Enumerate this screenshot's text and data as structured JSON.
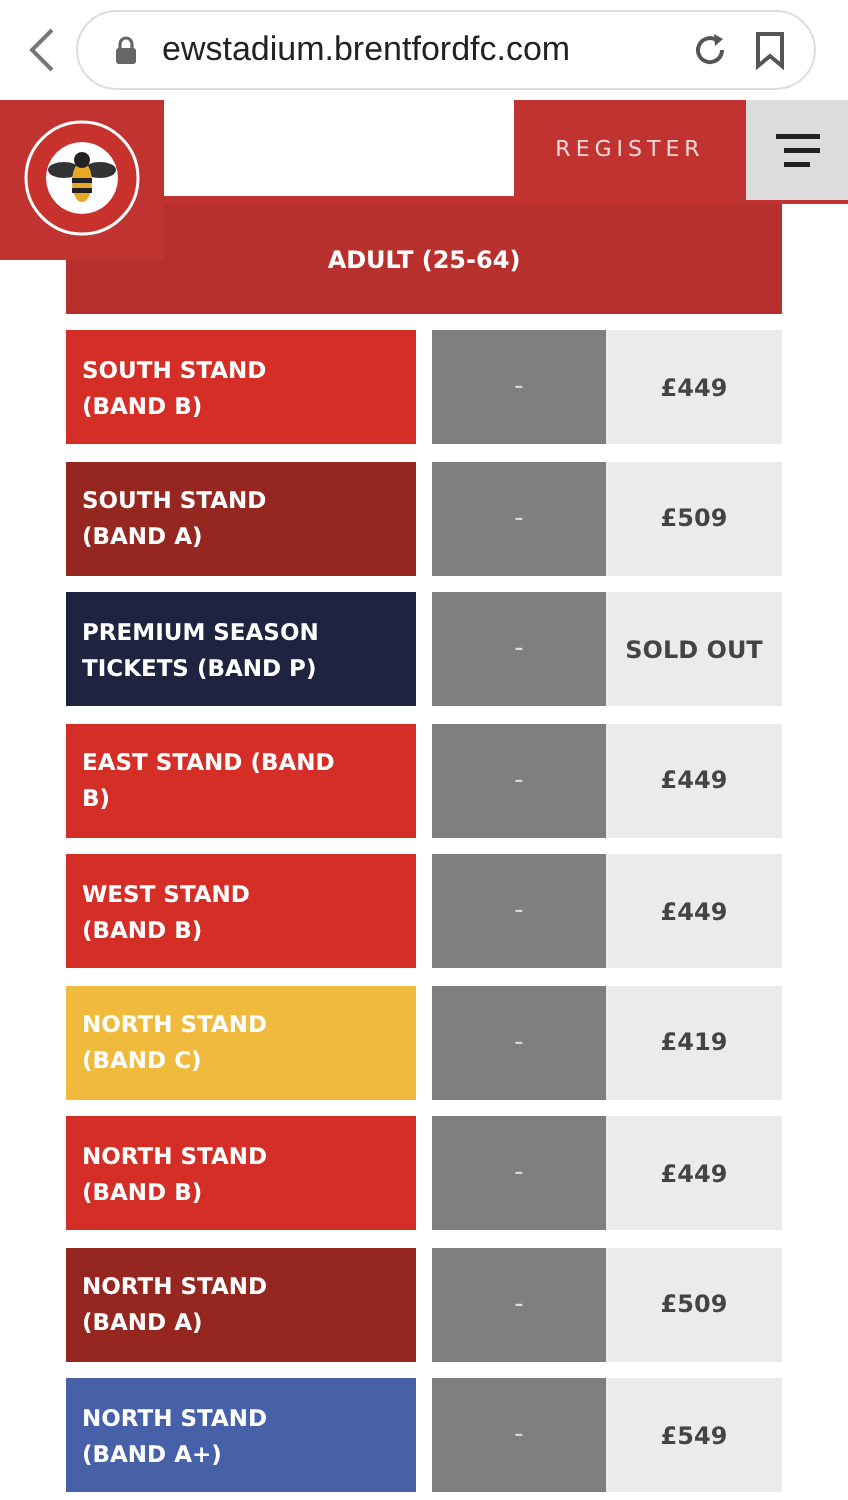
{
  "browser": {
    "url": "ewstadium.brentfordfc.com"
  },
  "header": {
    "register": "REGISTER"
  },
  "category": "ADULT (25-64)",
  "rows": [
    {
      "name": "SOUTH STAND (BAND B)",
      "color": "#d42e27",
      "column_2": "-",
      "price": "£449"
    },
    {
      "name": "SOUTH STAND (BAND A)",
      "color": "#952620",
      "column_2": "-",
      "price": "£509"
    },
    {
      "name": "PREMIUM SEASON TICKETS (BAND P)",
      "color": "#1e2340",
      "column_2": "-",
      "price": "SOLD OUT"
    },
    {
      "name": "EAST STAND (BAND B)",
      "color": "#d42e27",
      "column_2": "-",
      "price": "£449"
    },
    {
      "name": "WEST STAND (BAND B)",
      "color": "#d42e27",
      "column_2": "-",
      "price": "£449"
    },
    {
      "name": "NORTH STAND (BAND C)",
      "color": "#f0bb3c",
      "column_2": "-",
      "price": "£419"
    },
    {
      "name": "NORTH STAND (BAND B)",
      "color": "#d42e27",
      "column_2": "-",
      "price": "£449"
    },
    {
      "name": "NORTH STAND (BAND A)",
      "color": "#952620",
      "column_2": "-",
      "price": "£509"
    },
    {
      "name": "NORTH STAND (BAND A+)",
      "color": "#4661a8",
      "column_2": "-",
      "price": "£549"
    }
  ]
}
